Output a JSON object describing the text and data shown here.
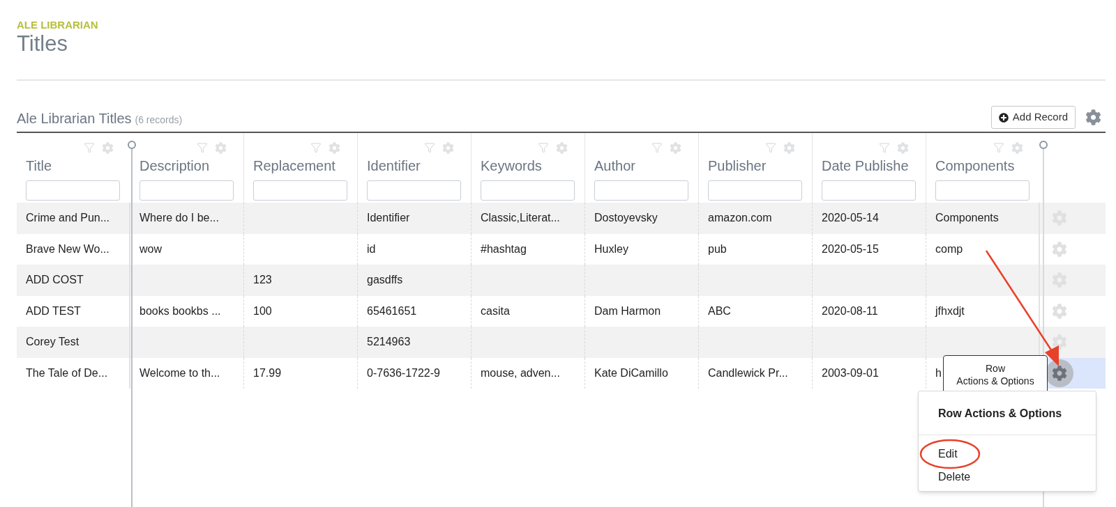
{
  "header": {
    "app": "ALE LIBRARIAN",
    "title": "Titles"
  },
  "toolbar": {
    "title": "Ale Librarian Titles",
    "count": "(6 records)",
    "add_button": "Add Record"
  },
  "columns": [
    {
      "label": "Title"
    },
    {
      "label": "Description"
    },
    {
      "label": "Replacement"
    },
    {
      "label": "Identifier"
    },
    {
      "label": "Keywords"
    },
    {
      "label": "Author"
    },
    {
      "label": "Publisher"
    },
    {
      "label": "Date Publishe"
    },
    {
      "label": "Components"
    }
  ],
  "rows": [
    {
      "selected": false,
      "cells": [
        "Crime and Pun...",
        "Where do I be...",
        "",
        "Identifier",
        "Classic,Literat...",
        "Dostoyevsky",
        "amazon.com",
        "2020-05-14",
        "Components"
      ]
    },
    {
      "selected": false,
      "cells": [
        "Brave New Wo...",
        "wow",
        "",
        "id",
        "#hashtag",
        "Huxley",
        "pub",
        "2020-05-15",
        "comp"
      ]
    },
    {
      "selected": false,
      "cells": [
        "ADD COST",
        "",
        "123",
        "gasdffs",
        "",
        "",
        "",
        "",
        ""
      ]
    },
    {
      "selected": false,
      "cells": [
        "ADD TEST",
        "books bookbs ...",
        "100",
        "65461651",
        "casita",
        "Dam Harmon",
        "ABC",
        "2020-08-11",
        "jfhxdjt"
      ]
    },
    {
      "selected": false,
      "cells": [
        "Corey Test",
        "",
        "",
        "5214963",
        "",
        "",
        "",
        "",
        ""
      ]
    },
    {
      "selected": true,
      "cells": [
        "The Tale of De...",
        "Welcome to th...",
        "17.99",
        "0-7636-1722-9",
        "mouse, adven...",
        "Kate DiCamillo",
        "Candlewick Pr...",
        "2003-09-01",
        "h"
      ]
    }
  ],
  "tooltip": {
    "line1": "Row",
    "line2": "Actions & Options"
  },
  "menu": {
    "title": "Row Actions & Options",
    "items": [
      {
        "label": "Edit",
        "circled": true
      },
      {
        "label": "Delete",
        "circled": false
      }
    ]
  }
}
